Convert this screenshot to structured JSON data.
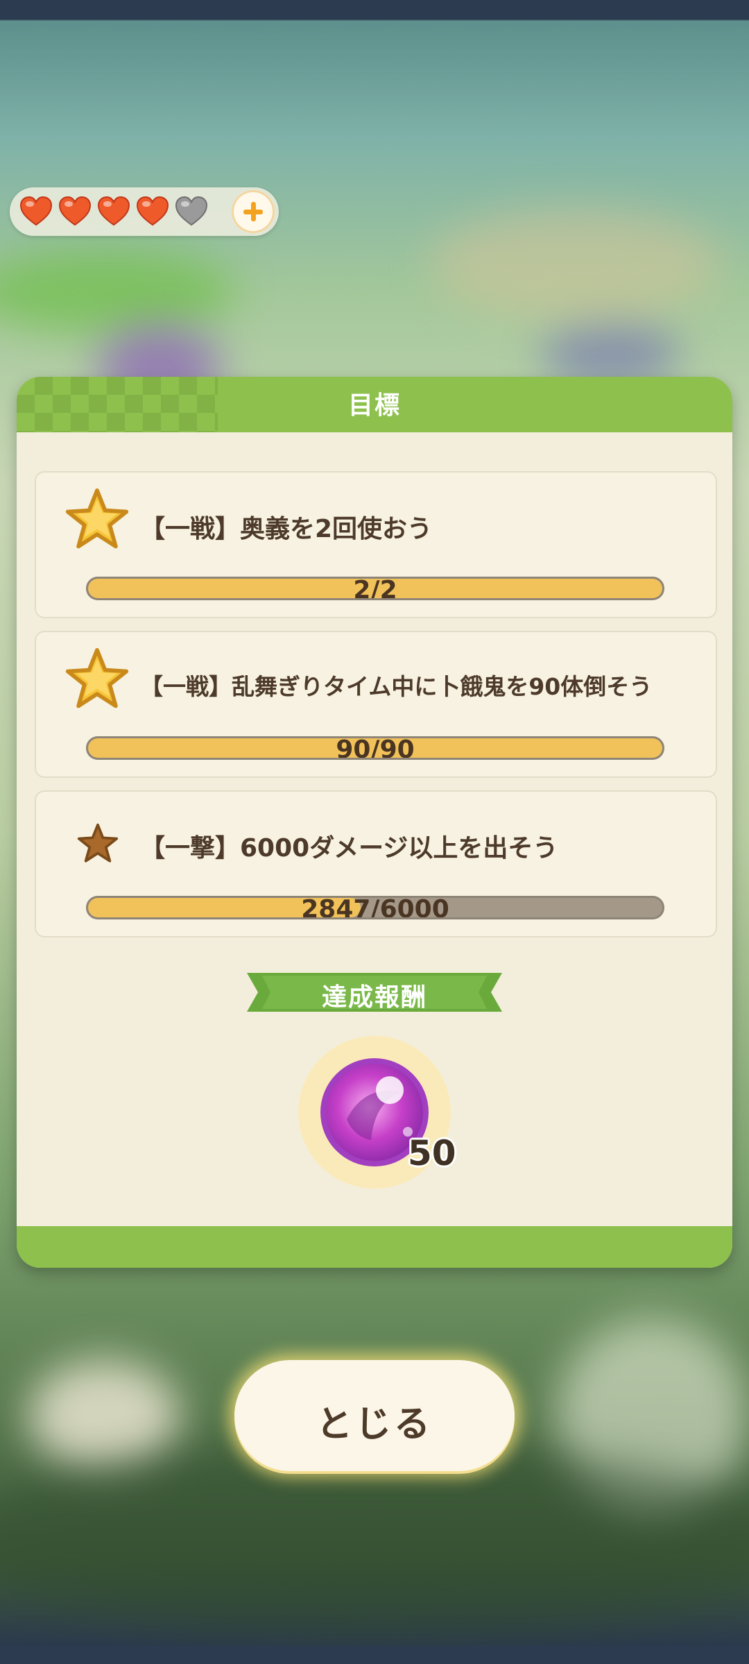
{
  "lives": {
    "filled": 4,
    "total": 5,
    "add_icon": "plus-icon",
    "colors": {
      "filled": "#ee5a2a",
      "empty": "#9a9a9a"
    }
  },
  "panel": {
    "title": "目標",
    "missions": [
      {
        "star": "gold-star",
        "text": "【一戦】奥義を2回使おう",
        "progress_label": "2/2",
        "progress": 1.0
      },
      {
        "star": "gold-star",
        "text": "【一戦】乱舞ぎりタイム中に卜餓鬼を90体倒そう",
        "progress_label": "90/90",
        "progress": 1.0
      },
      {
        "star": "bronze-star",
        "text": "【一撃】6000ダメージ以上を出そう",
        "progress_label": "2847/6000",
        "progress": 0.4745
      }
    ],
    "reward": {
      "ribbon": "達成報酬",
      "item_icon": "purple-orb-icon",
      "count": "50"
    }
  },
  "close_button": {
    "label": "とじる"
  },
  "colors": {
    "accent_green": "#8dc04c",
    "bar_fill": "#f2c25a",
    "panel_bg": "#f3eedc"
  }
}
